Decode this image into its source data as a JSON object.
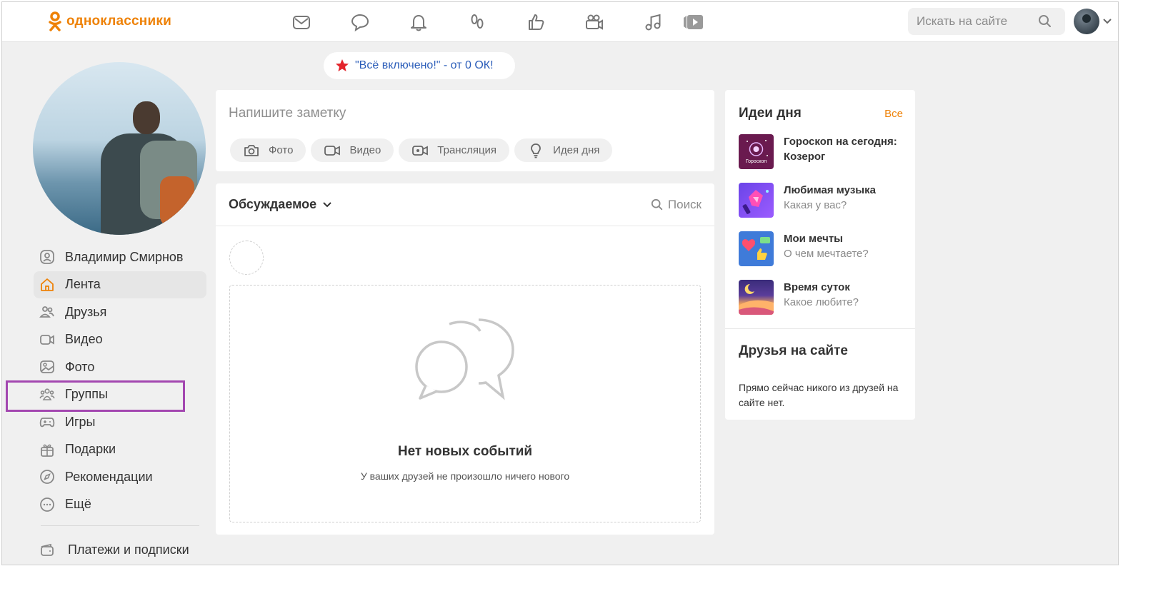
{
  "brand": {
    "name": "одноклассники",
    "color": "#ee8208"
  },
  "topbar": {
    "nav_icons": [
      "envelope-icon",
      "chat-icon",
      "bell-icon",
      "guests-icon",
      "thumbs-up-icon",
      "video-camera-icon",
      "music-icon",
      "play-icon"
    ],
    "search_placeholder": "Искать на сайте"
  },
  "promo": {
    "text": "\"Всё включено!\" - от 0 ОК!"
  },
  "sidebar": {
    "items": [
      {
        "label": "Владимир Смирнов",
        "icon": "profile-icon"
      },
      {
        "label": "Лента",
        "icon": "home-icon",
        "active": true
      },
      {
        "label": "Друзья",
        "icon": "friends-icon"
      },
      {
        "label": "Видео",
        "icon": "video-icon"
      },
      {
        "label": "Фото",
        "icon": "photo-icon"
      },
      {
        "label": "Группы",
        "icon": "groups-icon"
      },
      {
        "label": "Игры",
        "icon": "gamepad-icon"
      },
      {
        "label": "Подарки",
        "icon": "gift-icon"
      },
      {
        "label": "Рекомендации",
        "icon": "compass-icon"
      },
      {
        "label": "Ещё",
        "icon": "more-icon"
      }
    ],
    "payments": "Платежи и подписки"
  },
  "note": {
    "placeholder": "Напишите заметку",
    "actions": [
      "Фото",
      "Видео",
      "Трансляция",
      "Идея дня"
    ]
  },
  "feed": {
    "title": "Обсуждаемое",
    "search": "Поиск",
    "empty_title": "Нет новых событий",
    "empty_subtitle": "У ваших друзей не произошло ничего нового"
  },
  "ideas": {
    "title": "Идеи дня",
    "all": "Все",
    "items": [
      {
        "title": "Гороскоп на сегодня: Козерог",
        "subtitle": "",
        "thumb_label": "Гороскоп"
      },
      {
        "title": "Любимая музыка",
        "subtitle": "Какая у вас?"
      },
      {
        "title": "Мои мечты",
        "subtitle": "О чем мечтаете?"
      },
      {
        "title": "Время суток",
        "subtitle": "Какое любите?"
      }
    ]
  },
  "friends_online": {
    "title": "Друзья на сайте",
    "text": "Прямо сейчас никого из друзей на сайте нет."
  },
  "colors": {
    "accent": "#ee8208",
    "link": "#2b5db9",
    "highlight": "#a347b0"
  }
}
